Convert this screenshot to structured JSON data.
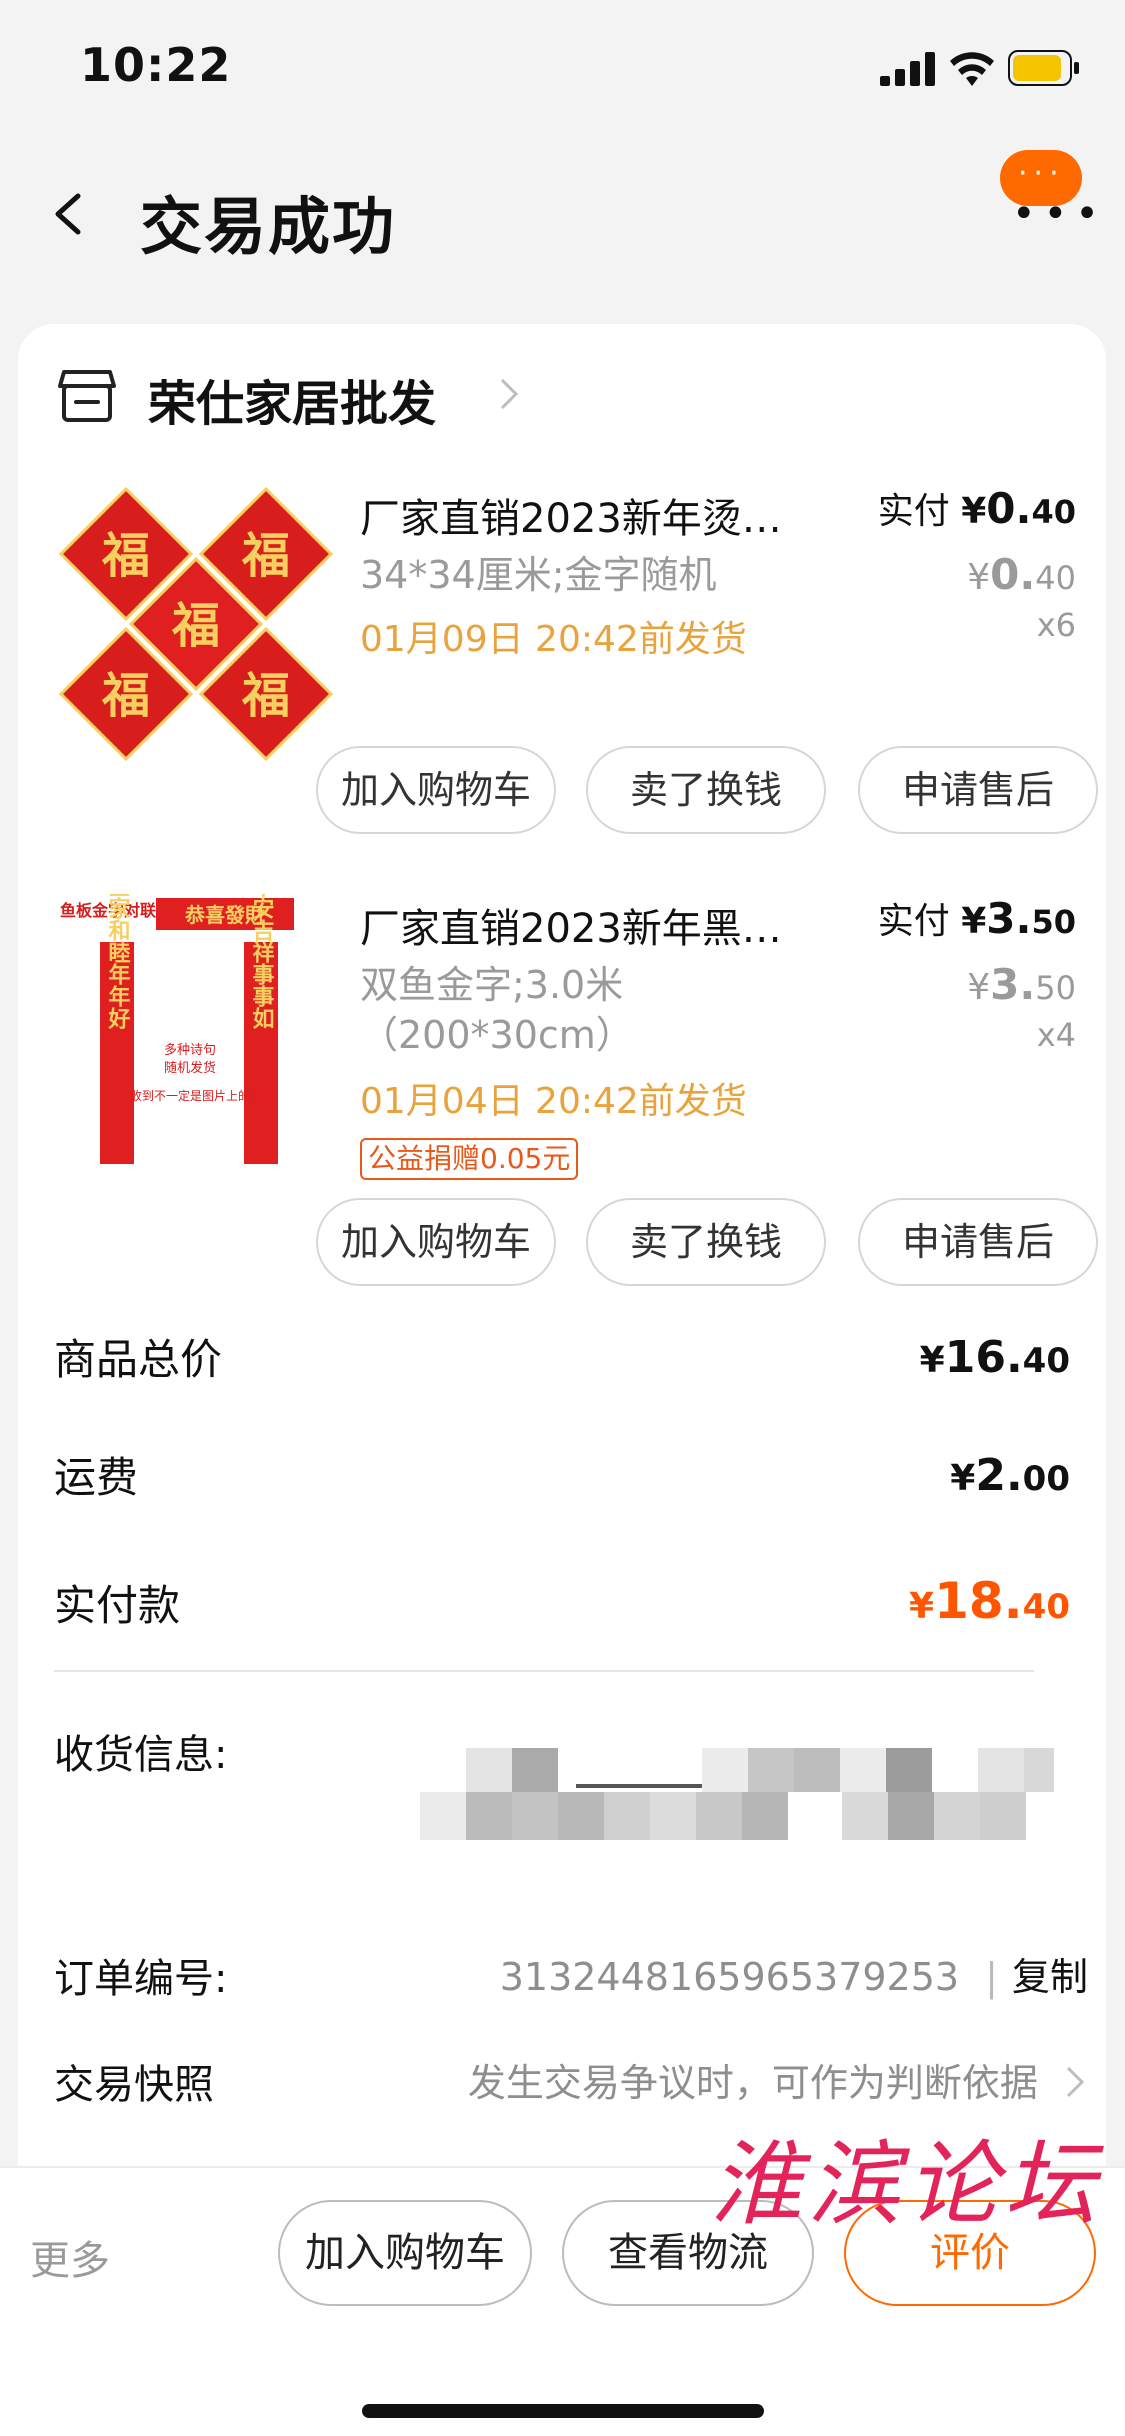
{
  "status_bar": {
    "time": "10:22"
  },
  "nav": {
    "title": "交易成功"
  },
  "shop": {
    "name": "荣仕家居批发"
  },
  "items": [
    {
      "title": "厂家直销2023新年烫…",
      "paid_label": "实付",
      "paid_symbol": "¥",
      "paid_int": "0.",
      "paid_dec": "40",
      "spec_line1": "34*34厘米;金字随机",
      "spec_line2": "",
      "orig_symbol": "¥",
      "orig_int": "0.",
      "orig_dec": "40",
      "qty": "x6",
      "ship": "01月09日 20:42前发货",
      "charity": "",
      "buttons": [
        "加入购物车",
        "卖了换钱",
        "申请售后"
      ],
      "image_text": [
        "福",
        "福",
        "福",
        "福",
        "福"
      ]
    },
    {
      "title": "厂家直销2023新年黑…",
      "paid_label": "实付",
      "paid_symbol": "¥",
      "paid_int": "3.",
      "paid_dec": "50",
      "spec_line1": "双鱼金字;3.0米",
      "spec_line2": "（200*30cm）",
      "orig_symbol": "¥",
      "orig_int": "3.",
      "orig_dec": "50",
      "qty": "x4",
      "ship": "01月04日 20:42前发货",
      "charity": "公益捐赠0.05元",
      "buttons": [
        "加入购物车",
        "卖了换钱",
        "申请售后"
      ],
      "image_text": {
        "tag": "鱼板金字对联",
        "banner": "恭喜發財",
        "left": "全家和睦年年好",
        "right": "平安吉祥事事如",
        "note1": "多种诗句",
        "note2": "随机发货",
        "note3": "收到不一定是图片上的"
      }
    }
  ],
  "summary": {
    "goods_total_label": "商品总价",
    "goods_total_symbol": "¥",
    "goods_total_int": "16.",
    "goods_total_dec": "40",
    "shipping_label": "运费",
    "shipping_symbol": "¥",
    "shipping_int": "2.",
    "shipping_dec": "00",
    "paid_label": "实付款",
    "paid_symbol": "¥",
    "paid_int": "18.",
    "paid_dec": "40"
  },
  "info": {
    "address_label": "收货信息:",
    "order_no_label": "订单编号:",
    "order_no": "3132448165965379253",
    "copy_label": "复制",
    "snapshot_label": "交易快照",
    "snapshot_value": "发生交易争议时，可作为判断依据"
  },
  "bottom_bar": {
    "more": "更多",
    "add_cart": "加入购物车",
    "logistics": "查看物流",
    "review": "评价"
  },
  "watermark": "淮滨论坛",
  "colors": {
    "accent": "#ff6a00",
    "price_total": "#ff5500",
    "ship_text": "#e8a33d",
    "charity": "#e85a1a"
  }
}
